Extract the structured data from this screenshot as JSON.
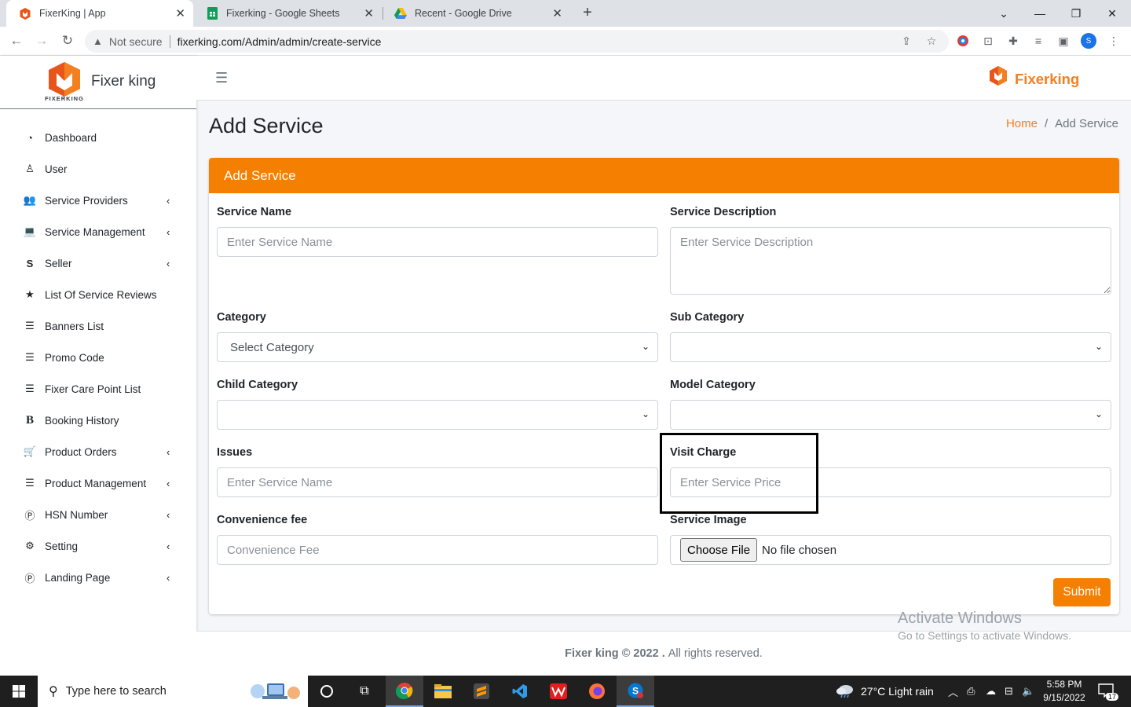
{
  "browser": {
    "tabs": [
      {
        "title": "FixerKing | App",
        "active": true
      },
      {
        "title": "Fixerking - Google Sheets",
        "active": false
      },
      {
        "title": "Recent - Google Drive",
        "active": false
      }
    ],
    "security_label": "Not secure",
    "url": "fixerking.com/Admin/admin/create-service",
    "profile_initial": "S"
  },
  "sidebar": {
    "brand": "Fixer king",
    "logo_caption": "FIXERKING",
    "items": [
      {
        "label": "Dashboard",
        "icon": "tachometer-icon",
        "glyph": "◔",
        "chevron": false
      },
      {
        "label": "User",
        "icon": "user-icon",
        "glyph": "♙",
        "chevron": false
      },
      {
        "label": "Service Providers",
        "icon": "users-icon",
        "glyph": "👥",
        "chevron": true
      },
      {
        "label": "Service Management",
        "icon": "laptop-icon",
        "glyph": "💻",
        "chevron": true
      },
      {
        "label": "Seller",
        "icon": "seller-s-icon",
        "glyph": "S",
        "chevron": true
      },
      {
        "label": "List Of Service Reviews",
        "icon": "star-icon",
        "glyph": "★",
        "chevron": false
      },
      {
        "label": "Banners List",
        "icon": "list-icon",
        "glyph": "☰",
        "chevron": false
      },
      {
        "label": "Promo Code",
        "icon": "list-icon",
        "glyph": "☰",
        "chevron": false
      },
      {
        "label": "Fixer Care Point List",
        "icon": "list-icon",
        "glyph": "☰",
        "chevron": false
      },
      {
        "label": "Booking History",
        "icon": "bold-b-icon",
        "glyph": "B",
        "chevron": false
      },
      {
        "label": "Product Orders",
        "icon": "cart-icon",
        "glyph": "🛒",
        "chevron": true
      },
      {
        "label": "Product Management",
        "icon": "list-icon",
        "glyph": "☰",
        "chevron": true
      },
      {
        "label": "HSN Number",
        "icon": "p-circle-icon",
        "glyph": "Ⓟ",
        "chevron": true
      },
      {
        "label": "Setting",
        "icon": "cogs-icon",
        "glyph": "⚙",
        "chevron": true
      },
      {
        "label": "Landing Page",
        "icon": "p-circle-icon",
        "glyph": "Ⓟ",
        "chevron": true
      }
    ]
  },
  "topbar": {
    "brand": "Fixerking"
  },
  "page": {
    "title": "Add Service",
    "breadcrumb_home": "Home",
    "breadcrumb_sep": "/",
    "breadcrumb_current": "Add Service"
  },
  "form": {
    "header": "Add Service",
    "service_name_label": "Service Name",
    "service_name_placeholder": "Enter Service Name",
    "service_description_label": "Service Description",
    "service_description_placeholder": "Enter Service Description",
    "category_label": "Category",
    "category_value": "Select Category",
    "sub_category_label": "Sub Category",
    "sub_category_value": "",
    "child_category_label": "Child Category",
    "child_category_value": "",
    "model_category_label": "Model Category",
    "model_category_value": "",
    "issues_label": "Issues",
    "issues_placeholder": "Enter Service Name",
    "visit_charge_label": "Visit Charge",
    "visit_charge_placeholder": "Enter Service Price",
    "convenience_fee_label": "Convenience fee",
    "convenience_fee_placeholder": "Convenience Fee",
    "service_image_label": "Service Image",
    "file_button": "Choose File",
    "file_status": "No file chosen",
    "submit": "Submit"
  },
  "footer": {
    "brand": "Fixer king © 2022 .",
    "rights": "All rights reserved."
  },
  "watermark": {
    "line1": "Activate Windows",
    "line2": "Go to Settings to activate Windows."
  },
  "taskbar": {
    "search_placeholder": "Type here to search",
    "weather": "27°C  Light rain",
    "time": "5:58 PM",
    "date": "9/15/2022",
    "notifications": "17"
  },
  "colors": {
    "accent": "#f47f00",
    "brand_text": "#f47f20"
  }
}
